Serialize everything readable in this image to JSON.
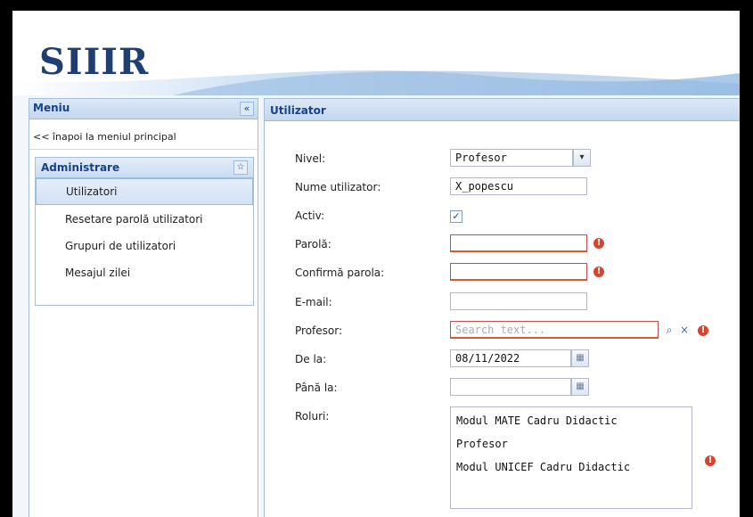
{
  "app": {
    "title": "SIIIR"
  },
  "colors": {
    "accent": "#15428b",
    "error": "#d8452f",
    "border": "#99bbe8"
  },
  "menu": {
    "title": "Meniu",
    "collapse_icon": "«",
    "back_link": "<< înapoi la meniul principal",
    "section": {
      "title": "Administrare",
      "toggle_icon": "☆",
      "items": [
        {
          "label": "Utilizatori",
          "selected": true
        },
        {
          "label": "Resetare parolă utilizatori",
          "selected": false
        },
        {
          "label": "Grupuri de utilizatori",
          "selected": false
        },
        {
          "label": "Mesajul zilei",
          "selected": false
        }
      ]
    }
  },
  "form": {
    "title": "Utilizator",
    "fields": {
      "nivel": {
        "label": "Nivel:",
        "value": "Profesor"
      },
      "nume": {
        "label": "Nume utilizator:",
        "value": "X_popescu"
      },
      "activ": {
        "label": "Activ:",
        "checked": true,
        "check_glyph": "✓"
      },
      "parola": {
        "label": "Parolă:",
        "value": ""
      },
      "confirma": {
        "label": "Confirmă parola:",
        "value": ""
      },
      "email": {
        "label": "E-mail:",
        "value": ""
      },
      "profesor": {
        "label": "Profesor:",
        "placeholder": "Search text..."
      },
      "de_la": {
        "label": "De la:",
        "value": "08/11/2022"
      },
      "pana_la": {
        "label": "Până la:",
        "value": ""
      },
      "roluri": {
        "label": "Roluri:",
        "items": [
          "Modul MATE Cadru Didactic",
          "Profesor",
          "Modul UNICEF Cadru Didactic"
        ]
      }
    },
    "icons": {
      "error": "!",
      "search": "⌕",
      "clear": "×",
      "dropdown": "▾",
      "calendar": "▦"
    }
  }
}
